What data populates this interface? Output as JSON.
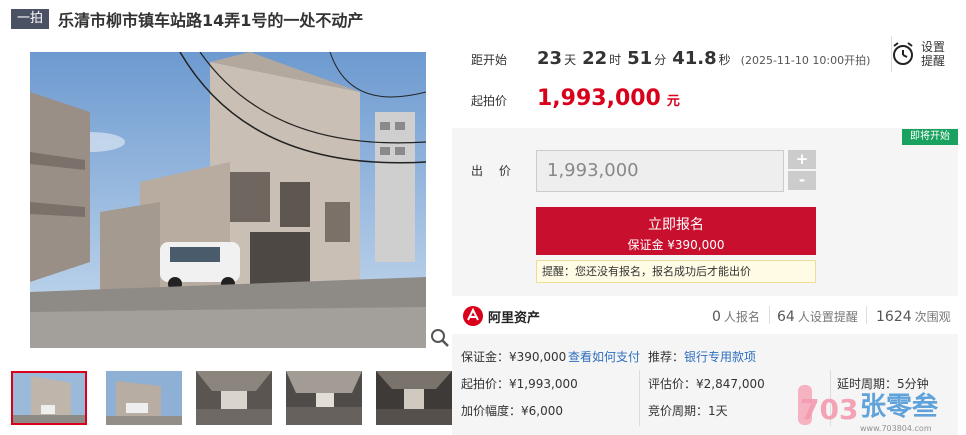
{
  "header": {
    "round_tag": "一拍",
    "title": "乐清市柳市镇车站路14弄1号的一处不动产"
  },
  "countdown": {
    "label": "距开始",
    "days": "23",
    "days_unit": "天",
    "hours": "22",
    "hours_unit": "时",
    "minutes": "51",
    "minutes_unit": "分",
    "seconds": "41.8",
    "seconds_unit": "秒",
    "start_note": "(2025-11-10 10:00开拍)"
  },
  "starting_price": {
    "label": "起拍价",
    "value": "1,993,000",
    "unit": "元"
  },
  "reminder": {
    "line1": "设置",
    "line2": "提醒",
    "icon": "alarm-clock-icon"
  },
  "bid": {
    "badge": "即将开始",
    "label": "出 价",
    "input_value": "1,993,000",
    "plus": "+",
    "minus": "-",
    "signup_label": "立即报名",
    "deposit_line": "保证金 ¥390,000",
    "tip": "提醒：您还没有报名，报名成功后才能出价"
  },
  "stats": {
    "logo_text": "阿里资产",
    "signups_num": "0",
    "signups_unit": "人报名",
    "reminders_num": "64",
    "reminders_unit": "人设置提醒",
    "views_num": "1624",
    "views_unit": "次围观"
  },
  "details": {
    "deposit_label": "保证金：",
    "deposit_value": "¥390,000",
    "how_to_pay": "查看如何支付",
    "recommend_label": "推荐：",
    "recommend_value": "银行专用款项",
    "start_label": "起拍价：",
    "start_value": "¥1,993,000",
    "appraisal_label": "评估价：",
    "appraisal_value": "¥2,847,000",
    "delay_label": "延时周期：",
    "delay_value": "5分钟",
    "increment_label": "加价幅度：",
    "increment_value": "¥6,000",
    "cycle_label": "竞价周期：",
    "cycle_value": "1天"
  },
  "watermark": {
    "brand": "张零叁",
    "url": "www.703804.com",
    "logo": "703"
  },
  "colors": {
    "accent_red": "#c8102e",
    "price_red": "#d9001b",
    "badge_green": "#19a15f",
    "link_blue": "#2f6fbf",
    "tag_gray": "#4a5163"
  }
}
